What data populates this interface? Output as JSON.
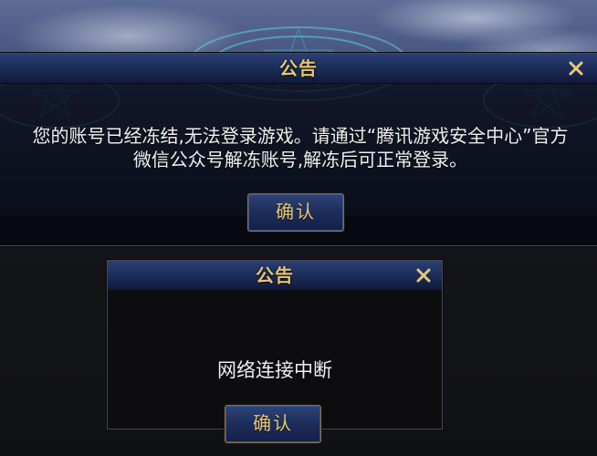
{
  "dialogs": {
    "account_frozen": {
      "title": "公告",
      "message": "您的账号已经冻结,无法登录游戏。请通过“腾讯游戏安全中心”官方微信公众号解冻账号,解冻后可正常登录。",
      "confirm_label": "确认",
      "close_icon": "close-icon"
    },
    "network": {
      "title": "公告",
      "message": "网络连接中断",
      "confirm_label": "确认",
      "close_icon": "close-icon"
    }
  },
  "colors": {
    "title_gold": "#e7c878",
    "titlebar_blue": "#1b2b57",
    "button_border": "#8a6f3b",
    "message_text": "#f1f1f1"
  }
}
